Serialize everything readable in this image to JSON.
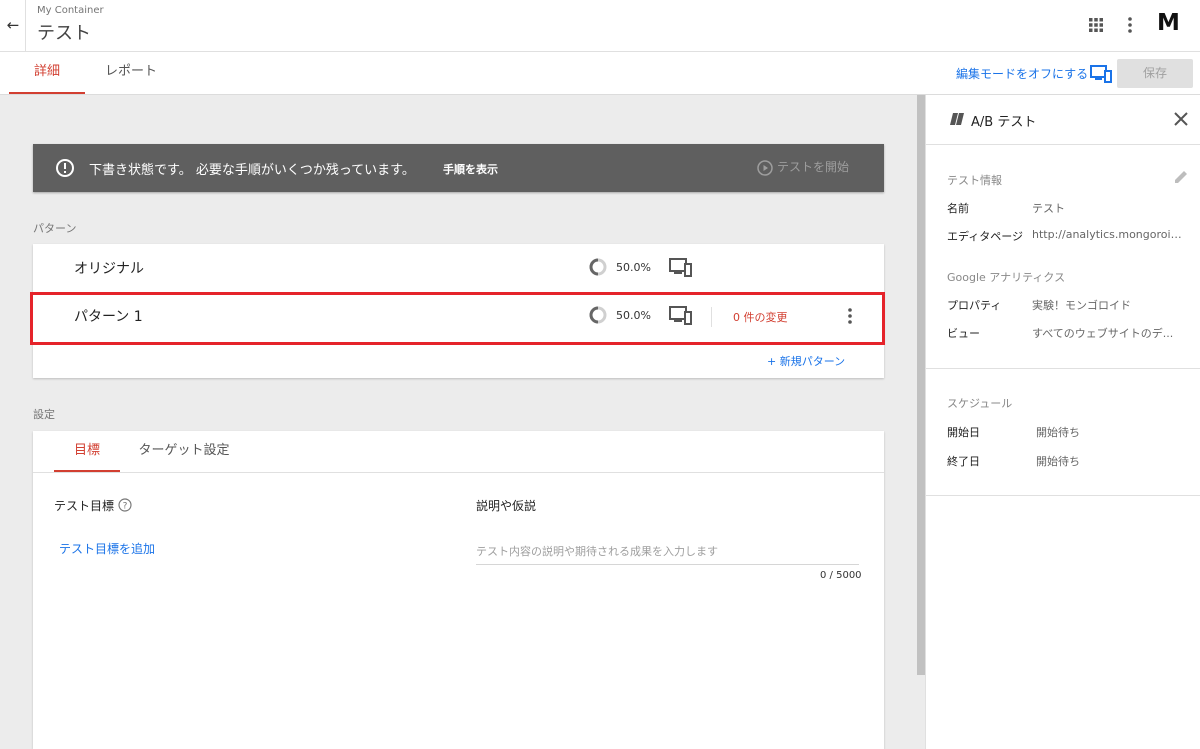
{
  "header": {
    "container_name": "My Container",
    "title": "テスト",
    "logo": "M"
  },
  "tabs": {
    "detail": "詳細",
    "report": "レポート"
  },
  "toolbar": {
    "edit_mode_link": "編集モードをオフにする",
    "save": "保存"
  },
  "banner": {
    "text": "下書き状態です。 必要な手順がいくつか残っています。",
    "show_steps": "手順を表示",
    "start_test": "テストを開始"
  },
  "patterns": {
    "section_label": "パターン",
    "rows": [
      {
        "name": "オリジナル",
        "traffic": "50.0%"
      },
      {
        "name": "パターン 1",
        "traffic": "50.0%",
        "changes": "0 件の変更"
      }
    ],
    "new_pattern": "+ 新規パターン"
  },
  "settings": {
    "section_label": "設定",
    "tabs": {
      "goal": "目標",
      "target": "ターゲット設定"
    },
    "goal_label": "テスト目標",
    "add_goal": "テスト目標を追加",
    "description_label": "説明や仮説",
    "description_placeholder": "テスト内容の説明や期待される成果を入力します",
    "char_count": "0 / 5000"
  },
  "right_panel": {
    "title": "A/B テスト",
    "test_info": {
      "label": "テスト情報",
      "name_key": "名前",
      "name_value": "テスト",
      "editor_key": "エディタページ",
      "editor_value": "http://analytics.mongoroid...."
    },
    "analytics": {
      "label": "Google アナリティクス",
      "property_key": "プロパティ",
      "property_value": "実験！モンゴロイド",
      "view_key": "ビュー",
      "view_value": "すべてのウェブサイトのデ..."
    },
    "schedule": {
      "label": "スケジュール",
      "start_key": "開始日",
      "start_value": "開始待ち",
      "end_key": "終了日",
      "end_value": "開始待ち"
    }
  },
  "colors": {
    "accent_red": "#d23f31",
    "link_blue": "#1a73e8",
    "highlight": "#e5232a"
  }
}
